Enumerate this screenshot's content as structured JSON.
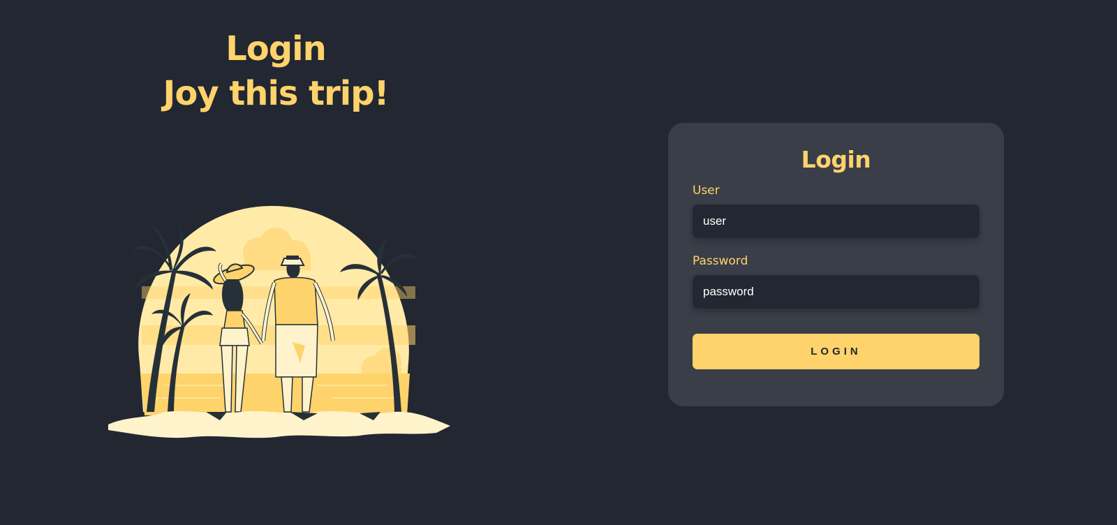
{
  "hero": {
    "line1": "Login",
    "line2": "Joy this trip!"
  },
  "illustration": {
    "icon": "beach-couple-illustration"
  },
  "login_card": {
    "title": "Login",
    "user_label": "User",
    "user_placeholder": "user",
    "password_label": "Password",
    "password_placeholder": "password",
    "button_label": "LOGIN"
  },
  "colors": {
    "background": "#222731",
    "card": "#3a3e48",
    "accent": "#ffd36b",
    "sun": "#ffeaa8",
    "sand": "#fff3cc",
    "palm": "#263038"
  }
}
